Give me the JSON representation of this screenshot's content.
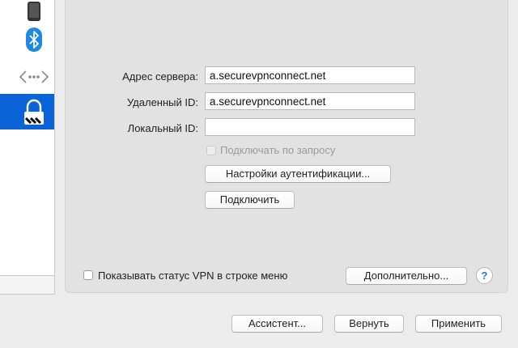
{
  "sidebar": {
    "items": [
      {
        "name": "iphone-usb",
        "icon": "iphone-icon"
      },
      {
        "name": "bluetooth-pan",
        "icon": "bluetooth-icon"
      },
      {
        "name": "thunderbolt-bridge",
        "icon": "network-arrows-icon"
      },
      {
        "name": "vpn",
        "icon": "vpn-lock-icon",
        "selected": true
      }
    ]
  },
  "form": {
    "server_address_label": "Адрес сервера:",
    "server_address_value": "a.securevpnconnect.net",
    "remote_id_label": "Удаленный ID:",
    "remote_id_value": "a.securevpnconnect.net",
    "local_id_label": "Локальный ID:",
    "local_id_value": "",
    "connect_on_demand_label": "Подключать по запросу",
    "auth_settings_button": "Настройки аутентификации...",
    "connect_button": "Подключить"
  },
  "panel_footer": {
    "show_vpn_status_label": "Показывать статус VPN в строке меню",
    "advanced_button": "Дополнительно...",
    "help_button": "?"
  },
  "window_footer": {
    "assistant_button": "Ассистент...",
    "revert_button": "Вернуть",
    "apply_button": "Применить"
  },
  "colors": {
    "selection": "#0a64d7",
    "help_icon": "#2a72d8"
  }
}
